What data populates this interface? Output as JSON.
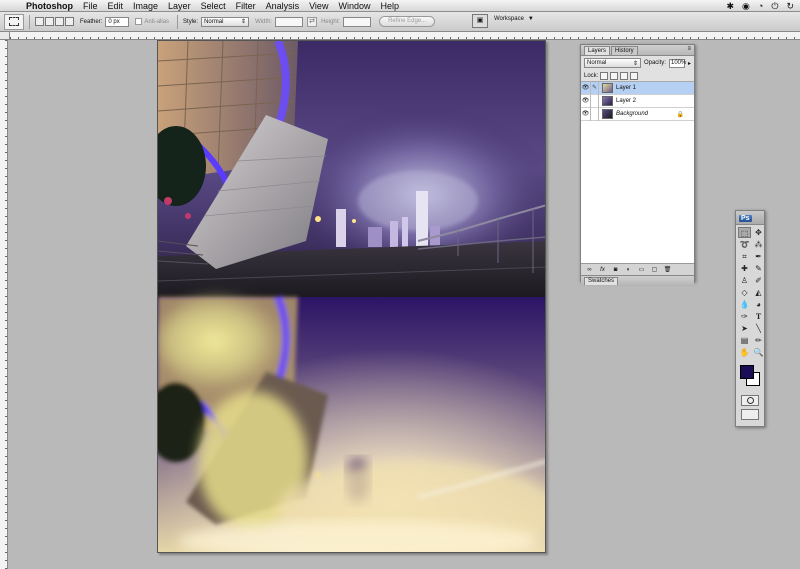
{
  "menubar": {
    "apple_glyph": "",
    "app_name": "Photoshop",
    "menus": [
      "File",
      "Edit",
      "Image",
      "Layer",
      "Select",
      "Filter",
      "Analysis",
      "View",
      "Window",
      "Help"
    ],
    "tray_glyphs": [
      "✱",
      "◉",
      "◔",
      "⏻",
      "↻"
    ]
  },
  "options_bar": {
    "feather_label": "Feather:",
    "feather_value": "0 px",
    "anti_alias_label": "Anti-alias",
    "style_label": "Style:",
    "style_value": "Normal",
    "width_label": "Width:",
    "height_label": "Height:",
    "refine_edge_label": "Refine Edge...",
    "workspace_label": "Workspace"
  },
  "layers_panel": {
    "tabs": [
      "Layers",
      "History"
    ],
    "blend_mode": "Normal",
    "opacity_label": "Opacity:",
    "opacity_value": "100%",
    "lock_label": "Lock:",
    "fill_label": "Fill:",
    "layers": [
      {
        "name": "Layer 1",
        "selected": true
      },
      {
        "name": "Layer 2",
        "selected": false
      },
      {
        "name": "Background",
        "selected": false,
        "locked": true
      }
    ],
    "bottom_tab": "Swatches"
  },
  "tools_panel": {
    "logo": "Ps",
    "tools": [
      "marquee-icon",
      "move-icon",
      "lasso-icon",
      "magic-wand-icon",
      "crop-icon",
      "eyedropper-icon",
      "healing-icon",
      "brush-icon",
      "stamp-icon",
      "history-brush-icon",
      "eraser-icon",
      "bucket-icon",
      "blur-icon",
      "dodge-icon",
      "pen-icon",
      "type-icon",
      "path-select-icon",
      "shape-icon",
      "notes-icon",
      "eyedrop2-icon",
      "hand-icon",
      "zoom-icon"
    ],
    "foreground_color": "#1a0d55",
    "background_color": "#ffffff"
  }
}
